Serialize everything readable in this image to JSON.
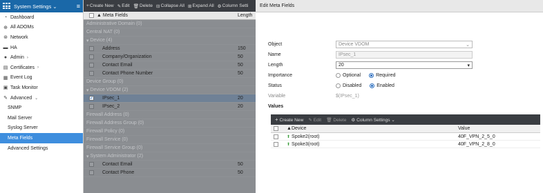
{
  "sidebar": {
    "title": "System Settings",
    "items": [
      {
        "label": "Dashboard",
        "icon": "dashboard-icon",
        "glyph": "◔"
      },
      {
        "label": "All ADOMs",
        "icon": "globe-icon",
        "glyph": "⊕"
      },
      {
        "label": "Network",
        "icon": "network-icon",
        "glyph": "⊛"
      },
      {
        "label": "HA",
        "icon": "ha-icon",
        "glyph": "▬"
      },
      {
        "label": "Admin",
        "icon": "user-icon",
        "glyph": "●"
      },
      {
        "label": "Certificates",
        "icon": "certificate-icon",
        "glyph": "▤"
      },
      {
        "label": "Event Log",
        "icon": "log-icon",
        "glyph": "▦"
      },
      {
        "label": "Task Monitor",
        "icon": "task-icon",
        "glyph": "▣"
      },
      {
        "label": "Advanced",
        "icon": "wrench-icon",
        "glyph": "✎"
      },
      {
        "label": "SNMP"
      },
      {
        "label": "Mail Server"
      },
      {
        "label": "Syslog Server"
      },
      {
        "label": "Meta Fields"
      },
      {
        "label": "Advanced Settings"
      }
    ]
  },
  "toolbar": {
    "create_new": "Create New",
    "edit": "Edit",
    "delete": "Delete",
    "collapse_all": "Collapse All",
    "expand_all": "Expand All",
    "column_settings": "Column Setti"
  },
  "list": {
    "col_meta": "Meta Fields",
    "col_length": "Length",
    "groups": {
      "admin_domain": "Administrative Domain (0)",
      "central_nat": "Central NAT (0)",
      "device": "Device (4)",
      "device_group": "Device Group (0)",
      "device_vdom": "Device VDOM (2)",
      "firewall_address": "Firewall Address (0)",
      "firewall_address_group": "Firewall Address Group (0)",
      "firewall_policy": "Firewall Policy (0)",
      "firewall_service": "Firewall Service (0)",
      "firewall_service_group": "Firewall Service Group (0)",
      "system_admin": "System Administrator (2)"
    },
    "device_items": [
      {
        "name": "Address",
        "length": "150"
      },
      {
        "name": "Company/Organization",
        "length": "50"
      },
      {
        "name": "Contact Email",
        "length": "50"
      },
      {
        "name": "Contact Phone Number",
        "length": "50"
      }
    ],
    "vdom_items": [
      {
        "name": "IPsec_1",
        "length": "20"
      },
      {
        "name": "IPsec_2",
        "length": "20"
      }
    ],
    "admin_items": [
      {
        "name": "Contact Email",
        "length": "50"
      },
      {
        "name": "Contact Phone",
        "length": "50"
      }
    ]
  },
  "panel": {
    "title": "Edit Meta Fields",
    "object_label": "Object",
    "object_value": "Device VDOM",
    "name_label": "Name",
    "name_value": "IPsec_1",
    "length_label": "Length",
    "length_value": "20",
    "importance_label": "Importance",
    "importance_optional": "Optional",
    "importance_required": "Required",
    "status_label": "Status",
    "status_disabled": "Disabled",
    "status_enabled": "Enabled",
    "variable_label": "Variable",
    "variable_value": "$(IPsec_1)",
    "values_label": "Values"
  },
  "values": {
    "create_new": "Create New",
    "edit": "Edit",
    "delete": "Delete",
    "column_settings": "Column Settings",
    "col_device": "Device",
    "col_value": "Value",
    "rows": [
      {
        "device": "Spoke2(root)",
        "value": "40F_VPN_2_5_0"
      },
      {
        "device": "Spoke3(root)",
        "value": "40F_VPN_2_8_0"
      }
    ]
  }
}
